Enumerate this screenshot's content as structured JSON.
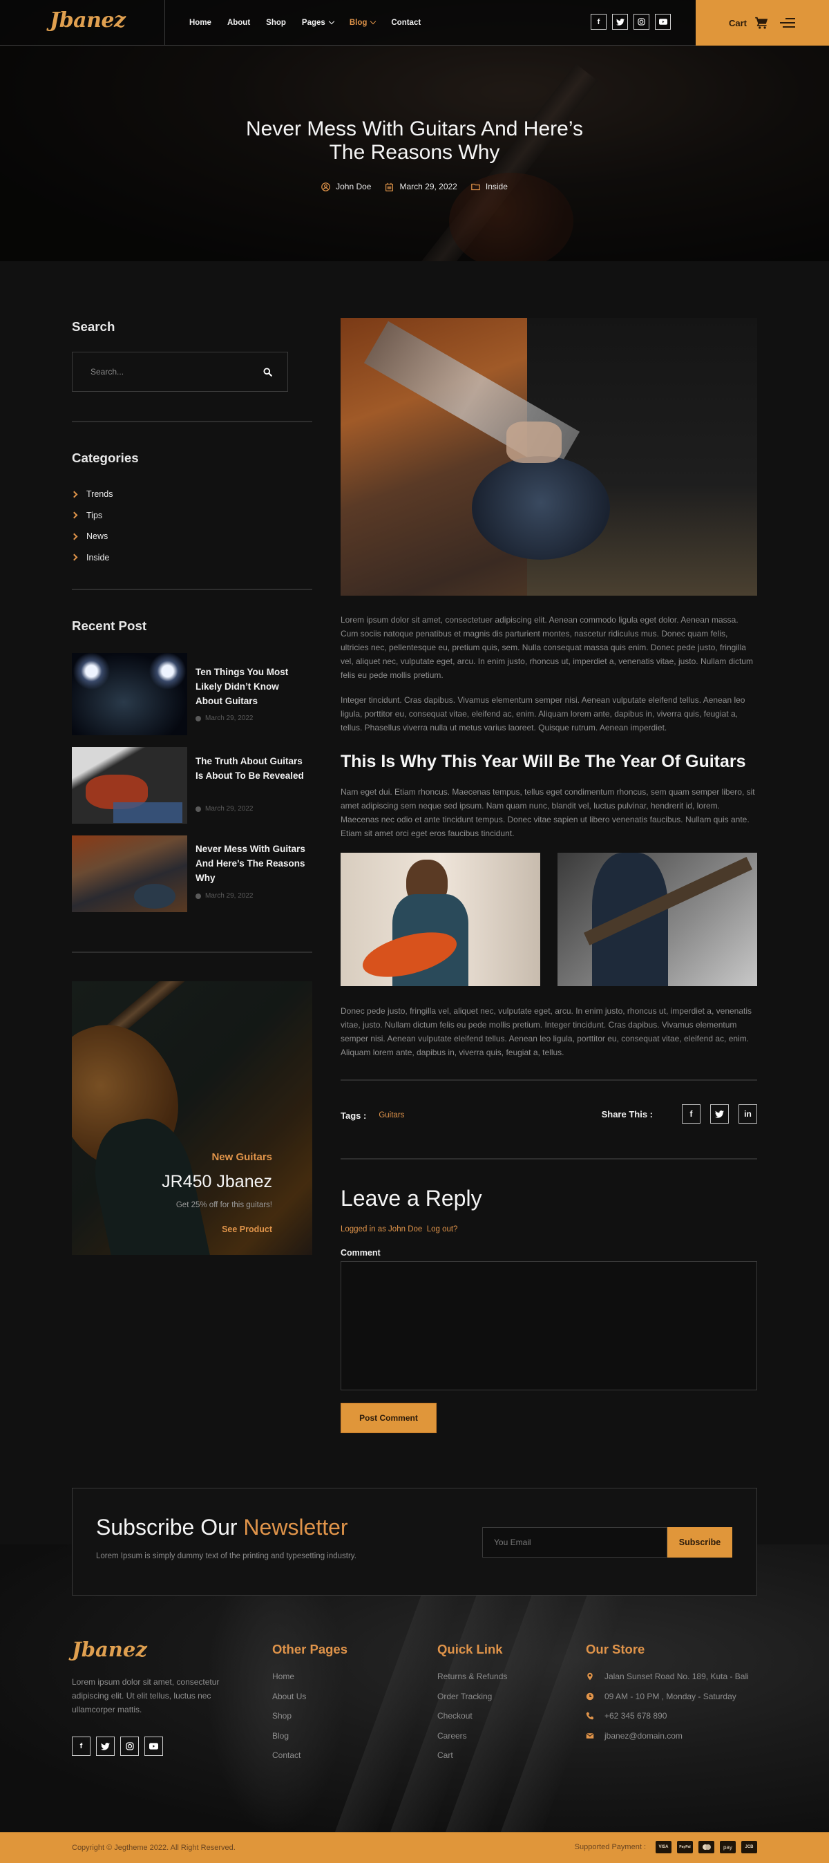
{
  "brand": {
    "name": "Jbanez",
    "accent": "#e0963a",
    "background": "#111111"
  },
  "header": {
    "nav": [
      {
        "label": "Home",
        "active": false,
        "dropdown": false
      },
      {
        "label": "About",
        "active": false,
        "dropdown": false
      },
      {
        "label": "Shop",
        "active": false,
        "dropdown": false
      },
      {
        "label": "Pages",
        "active": false,
        "dropdown": true
      },
      {
        "label": "Blog",
        "active": true,
        "dropdown": true
      },
      {
        "label": "Contact",
        "active": false,
        "dropdown": false
      }
    ],
    "socials": [
      "facebook-icon",
      "twitter-icon",
      "instagram-icon",
      "youtube-icon"
    ],
    "cart_label": "Cart"
  },
  "hero": {
    "title_line1": "Never Mess With Guitars And Here’s",
    "title_line2": "The Reasons Why",
    "author": "John Doe",
    "date": "March 29, 2022",
    "category": "Inside"
  },
  "sidebar": {
    "search": {
      "title": "Search",
      "placeholder": "Search..."
    },
    "categories": {
      "title": "Categories",
      "items": [
        "Trends",
        "Tips",
        "News",
        "Inside"
      ]
    },
    "recent": {
      "title": "Recent Post",
      "posts": [
        {
          "title": "Ten Things You Most Likely Didn’t Know About Guitars",
          "date": "March 29, 2022"
        },
        {
          "title": "The Truth About Guitars Is About To Be Revealed",
          "date": "March 29, 2022"
        },
        {
          "title": "Never Mess With Guitars And Here’s The Reasons Why",
          "date": "March 29, 2022"
        }
      ]
    },
    "promo": {
      "subtitle": "New Guitars",
      "title": "JR450 Jbanez",
      "description": "Get 25% off for this guitars!",
      "link": "See Product"
    }
  },
  "article": {
    "p1": "Lorem ipsum dolor sit amet, consectetuer adipiscing elit. Aenean commodo ligula eget dolor. Aenean massa. Cum sociis natoque penatibus et magnis dis parturient montes, nascetur ridiculus mus. Donec quam felis, ultricies nec, pellentesque eu, pretium quis, sem. Nulla consequat massa quis enim. Donec pede justo, fringilla vel, aliquet nec, vulputate eget, arcu. In enim justo, rhoncus ut, imperdiet a, venenatis vitae, justo. Nullam dictum felis eu pede mollis pretium.",
    "p2": "Integer tincidunt. Cras dapibus. Vivamus elementum semper nisi. Aenean vulputate eleifend tellus. Aenean leo ligula, porttitor eu, consequat vitae, eleifend ac, enim. Aliquam lorem ante, dapibus in, viverra quis, feugiat a, tellus. Phasellus viverra nulla ut metus varius laoreet. Quisque rutrum. Aenean imperdiet.",
    "heading": "This Is Why This Year Will Be The Year Of Guitars",
    "p3": "Nam eget dui. Etiam rhoncus. Maecenas tempus, tellus eget condimentum rhoncus, sem quam semper libero, sit amet adipiscing sem neque sed ipsum. Nam quam nunc, blandit vel, luctus pulvinar, hendrerit id, lorem. Maecenas nec odio et ante tincidunt tempus. Donec vitae sapien ut libero venenatis faucibus. Nullam quis ante. Etiam sit amet orci eget eros faucibus tincidunt.",
    "p4": "Donec pede justo, fringilla vel, aliquet nec, vulputate eget, arcu. In enim justo, rhoncus ut, imperdiet a, venenatis vitae, justo. Nullam dictum felis eu pede mollis pretium. Integer tincidunt. Cras dapibus. Vivamus elementum semper nisi. Aenean vulputate eleifend tellus. Aenean leo ligula, porttitor eu, consequat vitae, eleifend ac, enim. Aliquam lorem ante, dapibus in, viverra quis, feugiat a, tellus.",
    "tags_label": "Tags :",
    "tag": "Guitars",
    "share_label": "Share This :",
    "share_icons": [
      "facebook-icon",
      "twitter-icon",
      "linkedin-icon"
    ]
  },
  "reply": {
    "title": "Leave a Reply",
    "logged_in": "Logged in as John Doe",
    "logout": "Log out?",
    "comment_label": "Comment",
    "comment_value": "",
    "submit": "Post Comment"
  },
  "newsletter": {
    "title_plain": "Subscribe Our",
    "title_highlight": "Newsletter",
    "description": "Lorem Ipsum is simply dummy text of the printing and typesetting industry.",
    "email_placeholder": "You Email",
    "button": "Subscribe"
  },
  "footer": {
    "logo": "Jbanez",
    "description": "Lorem ipsum dolor sit amet, consectetur adipiscing elit. Ut elit tellus, luctus nec ullamcorper mattis.",
    "other_pages": {
      "title": "Other Pages",
      "links": [
        "Home",
        "About Us",
        "Shop",
        "Blog",
        "Contact"
      ]
    },
    "quick_link": {
      "title": "Quick Link",
      "links": [
        "Returns & Refunds",
        "Order Tracking",
        "Checkout",
        "Careers",
        "Cart"
      ]
    },
    "store": {
      "title": "Our Store",
      "address": "Jalan Sunset Road No. 189, Kuta - Bali",
      "hours": "09 AM - 10 PM , Monday - Saturday",
      "phone": "+62 345 678 890",
      "email": "jbanez@domain.com"
    },
    "copyright": "Copyright © Jegtheme 2022. All Right Reserved.",
    "payment_label": "Supported Payment :",
    "payments": [
      "VISA",
      "PayPal",
      "MC",
      "pay",
      "JCB"
    ]
  }
}
